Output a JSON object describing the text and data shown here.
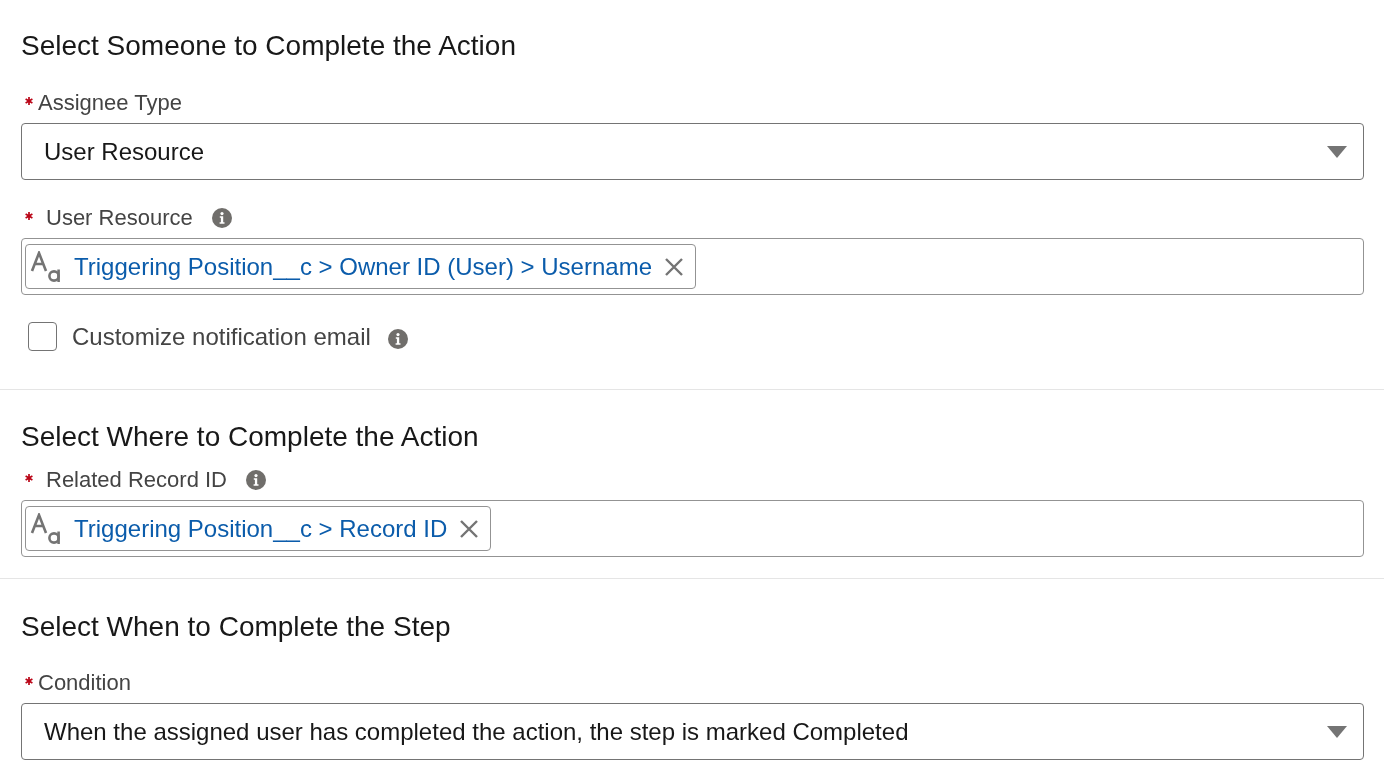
{
  "sections": [
    {
      "title": "Select Someone to Complete the Action",
      "fields": [
        {
          "kind": "picklist",
          "label": "Assignee Type",
          "required": true,
          "value": "User Resource"
        },
        {
          "kind": "resource",
          "label": "User Resource",
          "required": true,
          "info": true,
          "value": "Triggering Position__c > Owner ID (User) > Username"
        },
        {
          "kind": "checkbox",
          "label": "Customize notification email",
          "checked": false,
          "info": true
        }
      ]
    },
    {
      "title": "Select Where to Complete the Action",
      "fields": [
        {
          "kind": "resource",
          "label": "Related Record ID",
          "required": true,
          "info": true,
          "value": "Triggering Position__c > Record ID"
        }
      ]
    },
    {
      "title": "Select When to Complete the Step",
      "fields": [
        {
          "kind": "picklist",
          "label": "Condition",
          "required": true,
          "value": "When the assigned user has completed the action, the step is marked Completed"
        }
      ]
    }
  ]
}
